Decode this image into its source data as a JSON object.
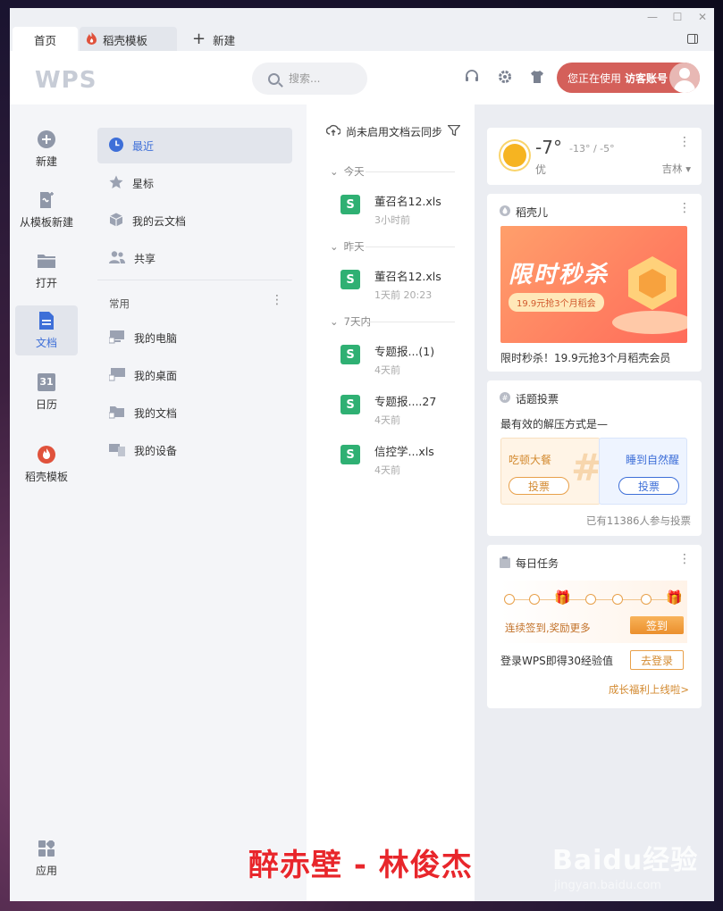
{
  "titlebar": {
    "tabs": [
      {
        "label": "首页"
      },
      {
        "label": "稻壳模板"
      },
      {
        "label": "新建"
      }
    ],
    "window_buttons": [
      "—",
      "☐",
      "✕"
    ]
  },
  "header": {
    "logo": "WPS",
    "search_placeholder": "搜索...",
    "account_prefix": "您正在使用",
    "account_name": "访客账号"
  },
  "leftnav": {
    "items": [
      {
        "label": "新建",
        "icon": "plus-circle-icon"
      },
      {
        "label": "从模板新建",
        "icon": "template-new-icon"
      },
      {
        "label": "打开",
        "icon": "folder-icon"
      },
      {
        "label": "文档",
        "icon": "document-icon"
      },
      {
        "label": "日历",
        "icon": "calendar-icon",
        "icon_text": "31"
      },
      {
        "label": "稻壳模板",
        "icon": "docer-icon"
      },
      {
        "label": "应用",
        "icon": "apps-icon"
      }
    ]
  },
  "panel2": {
    "items": [
      {
        "label": "最近"
      },
      {
        "label": "星标"
      },
      {
        "label": "我的云文档"
      },
      {
        "label": "共享"
      }
    ],
    "section": "常用",
    "common": [
      {
        "label": "我的电脑"
      },
      {
        "label": "我的桌面"
      },
      {
        "label": "我的文档"
      },
      {
        "label": "我的设备"
      }
    ]
  },
  "filelist": {
    "sync": "尚未启用文档云同步",
    "groups": [
      {
        "label": "今天"
      },
      {
        "label": "昨天"
      },
      {
        "label": "7天内"
      }
    ],
    "files": [
      {
        "name": "董召名12.xls",
        "time": "3小时前"
      },
      {
        "name": "董召名12.xls",
        "time": "1天前 20:23"
      },
      {
        "name": "专题报...(1)",
        "time": "4天前"
      },
      {
        "name": "专题报....27",
        "time": "4天前"
      },
      {
        "name": "信控学...xls",
        "time": "4天前"
      }
    ],
    "file_icon_letter": "S"
  },
  "weather": {
    "temp": "-7°",
    "range": "-13° / -5°",
    "quality": "优",
    "city": "吉林"
  },
  "docer": {
    "title": "稻壳儿",
    "banner_title": "限时秒杀",
    "banner_pill": "19.9元抢3个月稻会",
    "caption": "限时秒杀！19.9元抢3个月稻壳会员"
  },
  "poll": {
    "title": "话题投票",
    "question": "最有效的解压方式是—",
    "option_a": "吃顿大餐",
    "option_b": "睡到自然醒",
    "vote_label": "投票",
    "count": "已有11386人参与投票"
  },
  "tasks": {
    "title": "每日任务",
    "streak": "连续签到,奖励更多",
    "signin": "签到",
    "login_text": "登录WPS即得30经验值",
    "login_btn": "去登录",
    "growth": "成长福利上线啦>"
  },
  "overlay": {
    "lyric": "醉赤壁 - 林俊杰",
    "baidu": "Baidu经验",
    "baidu_sub": "jingyan.baidu.com"
  },
  "colors": {
    "accent_blue": "#3e6fd8",
    "account_red": "#d4605a",
    "sheet_green": "#2fb073",
    "task_orange": "#e8a04a"
  }
}
